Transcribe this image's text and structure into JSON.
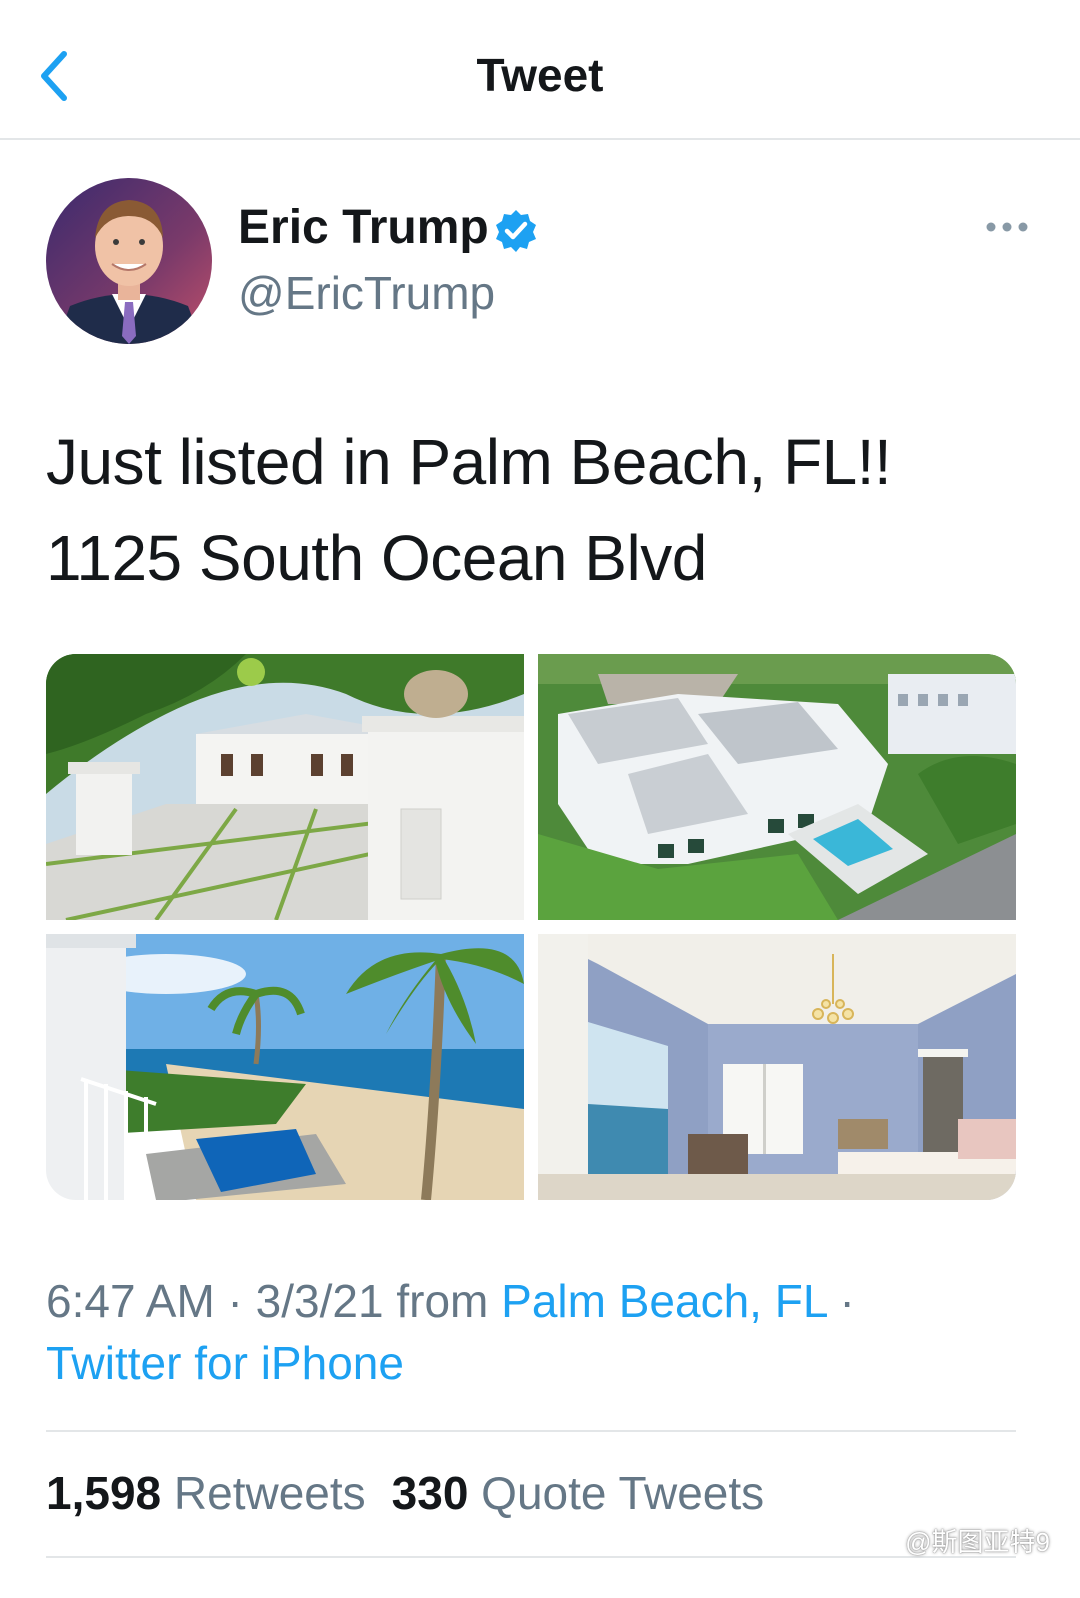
{
  "header": {
    "title": "Tweet",
    "back_icon": "chevron-left-icon"
  },
  "author": {
    "name": "Eric Trump",
    "handle": "@EricTrump",
    "verified": true,
    "avatar_icon": "avatar"
  },
  "tweet": {
    "lines": [
      "Just listed in Palm Beach, FL!!",
      "1125 South Ocean Blvd"
    ],
    "media": [
      {
        "label": "photo-driveway-entrance"
      },
      {
        "label": "photo-aerial-house-pool"
      },
      {
        "label": "photo-beach-pool-view"
      },
      {
        "label": "photo-bedroom-interior"
      }
    ]
  },
  "meta": {
    "time": "6:47 AM",
    "sep1": " · ",
    "date": "3/3/21",
    "from": " from ",
    "location": "Palm Beach, FL",
    "sep2": " ·",
    "client": "Twitter for iPhone"
  },
  "stats": {
    "retweets_count": "1,598",
    "retweets_label": " Retweets",
    "quotes_count": "330",
    "quotes_label": " Quote Tweets"
  },
  "watermark": "@斯图亚特9",
  "colors": {
    "accent": "#1da1f2",
    "secondary_text": "#657786",
    "primary_text": "#14171a"
  }
}
